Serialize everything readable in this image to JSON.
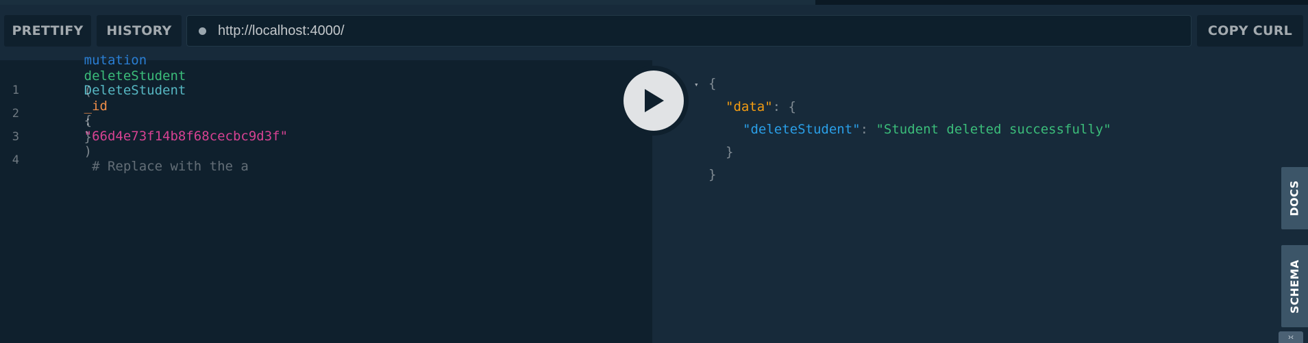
{
  "toolbar": {
    "prettify_label": "PRETTIFY",
    "history_label": "HISTORY",
    "url_value": "http://localhost:4000/",
    "copy_curl_label": "COPY CURL"
  },
  "editor": {
    "line_numbers": [
      "1",
      "2",
      "3",
      "4"
    ],
    "line1": {
      "keyword": "mutation",
      "name": "DeleteStudent",
      "brace": "{"
    },
    "line2": {
      "field": "deleteStudent",
      "paren_open": "(",
      "arg": "_id",
      "colon": ": ",
      "value": "\"66d4e73f14b8f68cecbc9d3f\"",
      "paren_close": ")",
      "comment": " # Replace with the a"
    },
    "line3": {
      "brace": "}"
    }
  },
  "result": {
    "open_brace": "{",
    "data_key": "\"data\"",
    "data_sep": ": {",
    "delete_key": "\"deleteStudent\"",
    "delete_sep": ": ",
    "delete_value": "\"Student deleted successfully\"",
    "inner_close": "}",
    "outer_close": "}"
  },
  "sidebar": {
    "docs_label": "DOCS",
    "schema_label": "SCHEMA"
  },
  "icons": {
    "play": "play-icon",
    "status": "status-dot-icon",
    "fold": "fold-arrow-icon",
    "collapse": "chevron-collapse-icon"
  },
  "colors": {
    "background": "#172a3a",
    "editor_bg": "#0f202d",
    "keyword": "#2a7ed3",
    "string": "#d64292",
    "result_key": "#f39c12",
    "result_string": "#3bbd7a"
  }
}
